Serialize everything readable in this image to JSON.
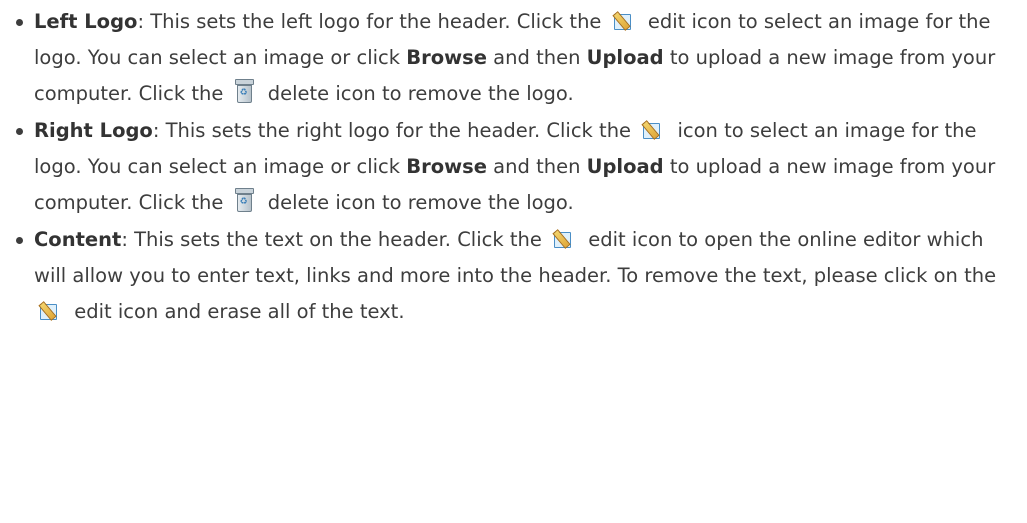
{
  "items": [
    {
      "term": "Left Logo",
      "t1": ": This sets the left logo for the header. Click the ",
      "t2": " edit icon to select an image for the logo. You can select an image or click ",
      "b1": "Browse",
      "t3": " and then ",
      "b2": "Upload",
      "t4": " to upload a new image from your computer. Click the ",
      "t5": " delete icon to remove the logo."
    },
    {
      "term": "Right Logo",
      "t1": ": This sets the right logo for the header. Click the ",
      "t2": " icon to select an image for the logo. You can select an image or click ",
      "b1": "Browse",
      "t3": " and then ",
      "b2": "Upload",
      "t4": " to upload a new image from your computer. Click the ",
      "t5": " delete icon to remove the logo."
    },
    {
      "term": "Content",
      "t1": ": This sets the text on the header. Click the ",
      "t2": " edit icon to open the online editor which will allow you to enter text, links and more into the header. To remove the text, please click on the ",
      "t3": " edit icon and erase all of the text."
    }
  ],
  "icons": {
    "edit": "edit-icon",
    "delete": "delete-icon"
  }
}
